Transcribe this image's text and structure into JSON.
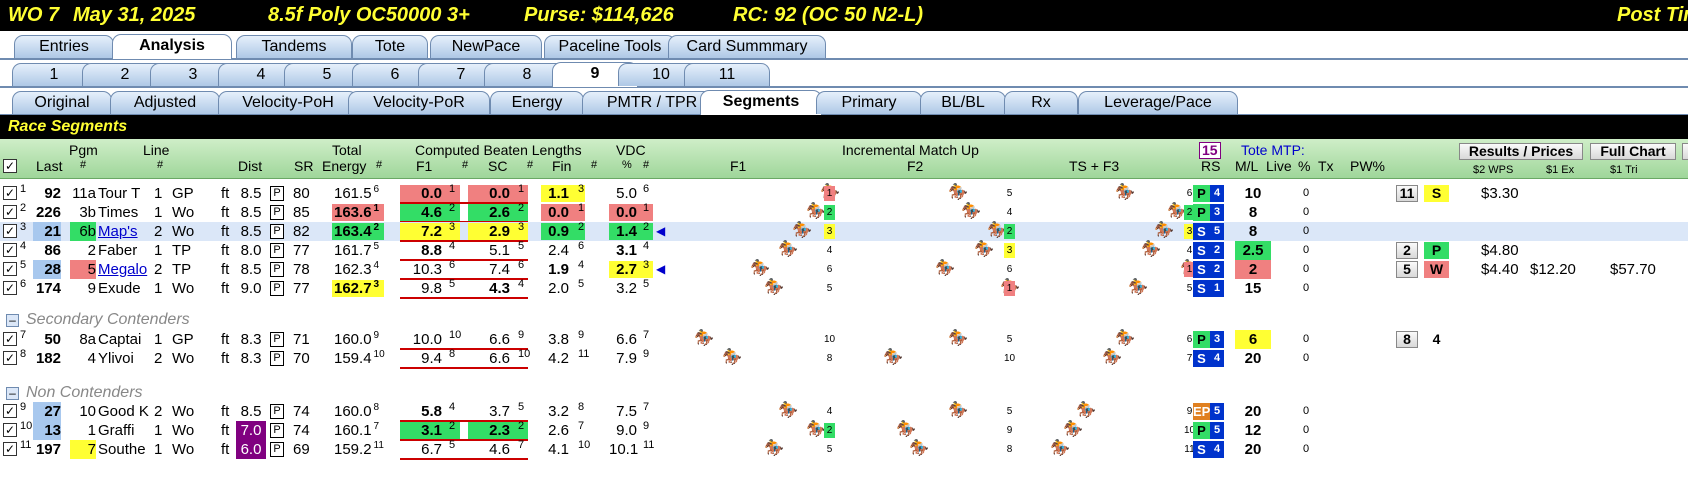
{
  "header": {
    "race": "WO  7",
    "date": "May 31, 2025",
    "conditions": "8.5f  Poly  OC50000  3+",
    "purse": "Purse: $114,626",
    "rc": "RC: 92  (OC 50 N2-L)",
    "post": "Post Tim"
  },
  "tabs_main": [
    "Entries",
    "Analysis",
    "Tandems",
    "Tote",
    "NewPace",
    "Paceline Tools",
    "Card Summmary"
  ],
  "tabs_races": [
    "1",
    "2",
    "3",
    "4",
    "5",
    "6",
    "7",
    "8",
    "9",
    "10",
    "11"
  ],
  "tabs_views": [
    "Original",
    "Adjusted",
    "Velocity-PoH",
    "Velocity-PoR",
    "Energy",
    "PMTR / TPR",
    "Segments",
    "Primary",
    "BL/BL",
    "Rx",
    "Leverage/Pace"
  ],
  "section_title": "Race Segments",
  "columns": {
    "last": "Last",
    "pgm": "Pgm",
    "pgm_hash": "#",
    "line": "Line",
    "line_hash": "#",
    "dist": "Dist",
    "sr": "SR",
    "total": "Total",
    "energy": "Energy",
    "energy_hash": "#",
    "cbl": "Computed Beaten Lengths",
    "f1": "F1",
    "f1_hash": "#",
    "sc": "SC",
    "sc_hash": "#",
    "fin": "Fin",
    "fin_hash": "#",
    "vdc": "VDC",
    "vdc_pct": "%",
    "vdc_hash": "#",
    "imu": "Incremental Match Up",
    "imu_f1": "F1",
    "imu_f2": "F2",
    "imu_ts": "TS + F3",
    "rs_count": "15",
    "rs": "RS",
    "tote_mtp": "Tote MTP:",
    "ml": "M/L",
    "live": "Live",
    "pct": "%",
    "tx": "Tx",
    "pw": "PW%",
    "results_btn": "Results / Prices",
    "fullchart_btn": "Full Chart",
    "wps": "$2 WPS",
    "ex": "$1 Ex",
    "tri": "$1 Tri"
  },
  "sections": {
    "secondary": "Secondary Contenders",
    "non": "Non Contenders"
  },
  "rows": [
    {
      "idx": "1",
      "last": "92",
      "pgm": "11a",
      "name": "Tour T",
      "line": "1",
      "trk": "GP",
      "surf": "ft",
      "dist": "8.5",
      "p": "P",
      "sr": "80",
      "energy": "161.5",
      "er": "6",
      "f1": "0.0",
      "f1r": "1",
      "sc": "0.0",
      "scr": "1",
      "fin": "1.1",
      "finr": "3",
      "vdc": "5.0",
      "vdcr": "6",
      "m1": "1",
      "m2": "5",
      "m3": "6",
      "rsl": "P",
      "rsr": "4",
      "ml": "10",
      "live": "0",
      "pos": "11",
      "posl": "S",
      "wps": "$3.30",
      "ex": "",
      "tri": ""
    },
    {
      "idx": "2",
      "last": "226",
      "pgm": "3b",
      "name": "Times",
      "line": "1",
      "trk": "Wo",
      "surf": "ft",
      "dist": "8.5",
      "p": "P",
      "sr": "85",
      "energy": "163.6",
      "er": "1",
      "f1": "4.6",
      "f1r": "2",
      "sc": "2.6",
      "scr": "2",
      "fin": "0.0",
      "finr": "1",
      "vdc": "0.0",
      "vdcr": "1",
      "m1": "2",
      "m2": "4",
      "m3": "2",
      "rsl": "P",
      "rsr": "3",
      "ml": "8",
      "live": "0",
      "pos": "",
      "posl": "",
      "wps": "",
      "ex": "",
      "tri": ""
    },
    {
      "idx": "3",
      "last": "21",
      "pgm": "6b",
      "name": "Map's",
      "line": "2",
      "trk": "Wo",
      "surf": "ft",
      "dist": "8.5",
      "p": "P",
      "sr": "82",
      "energy": "163.4",
      "er": "2",
      "f1": "7.2",
      "f1r": "3",
      "sc": "2.9",
      "scr": "3",
      "fin": "0.9",
      "finr": "2",
      "vdc": "1.4",
      "vdcr": "2",
      "m1": "3",
      "m2": "2",
      "m3": "3",
      "rsl": "S",
      "rsr": "5",
      "ml": "8",
      "live": "0",
      "pos": "",
      "posl": "",
      "wps": "",
      "ex": "",
      "tri": ""
    },
    {
      "idx": "4",
      "last": "86",
      "pgm": "2",
      "name": "Faber",
      "line": "1",
      "trk": "TP",
      "surf": "ft",
      "dist": "8.0",
      "p": "P",
      "sr": "77",
      "energy": "161.7",
      "er": "5",
      "f1": "8.8",
      "f1r": "4",
      "sc": "5.1",
      "scr": "5",
      "fin": "2.4",
      "finr": "6",
      "vdc": "3.1",
      "vdcr": "4",
      "m1": "4",
      "m2": "3",
      "m3": "4",
      "rsl": "S",
      "rsr": "2",
      "ml": "2.5",
      "live": "0",
      "pos": "2",
      "posl": "P",
      "wps": "$4.80",
      "ex": "",
      "tri": ""
    },
    {
      "idx": "5",
      "last": "28",
      "pgm": "5",
      "name": "Megalo",
      "line": "2",
      "trk": "TP",
      "surf": "ft",
      "dist": "8.5",
      "p": "P",
      "sr": "78",
      "energy": "162.3",
      "er": "4",
      "f1": "10.3",
      "f1r": "6",
      "sc": "7.4",
      "scr": "6",
      "fin": "1.9",
      "finr": "4",
      "vdc": "2.7",
      "vdcr": "3",
      "m1": "6",
      "m2": "6",
      "m3": "1",
      "rsl": "S",
      "rsr": "2",
      "ml": "2",
      "live": "0",
      "pos": "5",
      "posl": "W",
      "wps": "$4.40",
      "ex": "$12.20",
      "tri": "$57.70"
    },
    {
      "idx": "6",
      "last": "174",
      "pgm": "9",
      "name": "Exude",
      "line": "1",
      "trk": "Wo",
      "surf": "ft",
      "dist": "9.0",
      "p": "P",
      "sr": "77",
      "energy": "162.7",
      "er": "3",
      "f1": "9.8",
      "f1r": "5",
      "sc": "4.3",
      "scr": "4",
      "fin": "2.0",
      "finr": "5",
      "vdc": "3.2",
      "vdcr": "5",
      "m1": "5",
      "m2": "1",
      "m3": "5",
      "rsl": "S",
      "rsr": "1",
      "ml": "15",
      "live": "0",
      "pos": "",
      "posl": "",
      "wps": "",
      "ex": "",
      "tri": ""
    },
    {
      "idx": "7",
      "last": "50",
      "pgm": "8a",
      "name": "Captai",
      "line": "1",
      "trk": "GP",
      "surf": "ft",
      "dist": "8.3",
      "p": "P",
      "sr": "71",
      "energy": "160.0",
      "er": "9",
      "f1": "10.0",
      "f1r": "10",
      "sc": "6.6",
      "scr": "9",
      "fin": "3.8",
      "finr": "9",
      "vdc": "6.6",
      "vdcr": "7",
      "m1": "10",
      "m2": "5",
      "m3": "6",
      "rsl": "P",
      "rsr": "3",
      "ml": "6",
      "live": "0",
      "pos": "8",
      "posl": "4",
      "wps": "",
      "ex": "",
      "tri": ""
    },
    {
      "idx": "8",
      "last": "182",
      "pgm": "4",
      "name": "Ylivoi",
      "line": "2",
      "trk": "Wo",
      "surf": "ft",
      "dist": "8.3",
      "p": "P",
      "sr": "70",
      "energy": "159.4",
      "er": "10",
      "f1": "9.4",
      "f1r": "8",
      "sc": "6.6",
      "scr": "10",
      "fin": "4.2",
      "finr": "11",
      "vdc": "7.9",
      "vdcr": "9",
      "m1": "8",
      "m2": "10",
      "m3": "7",
      "rsl": "S",
      "rsr": "4",
      "ml": "20",
      "live": "0",
      "pos": "",
      "posl": "",
      "wps": "",
      "ex": "",
      "tri": ""
    },
    {
      "idx": "9",
      "last": "27",
      "pgm": "10",
      "name": "Good K",
      "line": "2",
      "trk": "Wo",
      "surf": "ft",
      "dist": "8.5",
      "p": "P",
      "sr": "74",
      "energy": "160.0",
      "er": "8",
      "f1": "5.8",
      "f1r": "4",
      "sc": "3.7",
      "scr": "5",
      "fin": "3.2",
      "finr": "8",
      "vdc": "7.5",
      "vdcr": "7",
      "m1": "4",
      "m2": "5",
      "m3": "9",
      "rsl": "EP",
      "rsr": "5",
      "ml": "20",
      "live": "0",
      "pos": "",
      "posl": "",
      "wps": "",
      "ex": "",
      "tri": ""
    },
    {
      "idx": "10",
      "last": "13",
      "pgm": "1",
      "name": "Graffi",
      "line": "1",
      "trk": "Wo",
      "surf": "ft",
      "dist": "7.0",
      "p": "P",
      "sr": "74",
      "energy": "160.1",
      "er": "7",
      "f1": "3.1",
      "f1r": "2",
      "sc": "2.3",
      "scr": "2",
      "fin": "2.6",
      "finr": "7",
      "vdc": "9.0",
      "vdcr": "9",
      "m1": "2",
      "m2": "9",
      "m3": "10",
      "rsl": "P",
      "rsr": "5",
      "ml": "12",
      "live": "0",
      "pos": "",
      "posl": "",
      "wps": "",
      "ex": "",
      "tri": ""
    },
    {
      "idx": "11",
      "last": "197",
      "pgm": "7",
      "name": "Southe",
      "line": "1",
      "trk": "Wo",
      "surf": "ft",
      "dist": "6.0",
      "p": "P",
      "sr": "69",
      "energy": "159.2",
      "er": "11",
      "f1": "6.7",
      "f1r": "5",
      "sc": "4.6",
      "scr": "7",
      "fin": "4.1",
      "finr": "10",
      "vdc": "10.1",
      "vdcr": "11",
      "m1": "5",
      "m2": "8",
      "m3": "11",
      "rsl": "S",
      "rsr": "4",
      "ml": "20",
      "live": "0",
      "pos": "",
      "posl": "",
      "wps": "",
      "ex": "",
      "tri": ""
    }
  ],
  "colors": {
    "red": "#f08080",
    "green": "#33dd66",
    "yellow": "#ffff33",
    "blue": "#0033cc",
    "purple": "#800080",
    "orange": "#e08020",
    "header_bg": "#000000",
    "header_fg": "#ffff33"
  },
  "icons": {
    "horse": "horse-racing-icon"
  }
}
